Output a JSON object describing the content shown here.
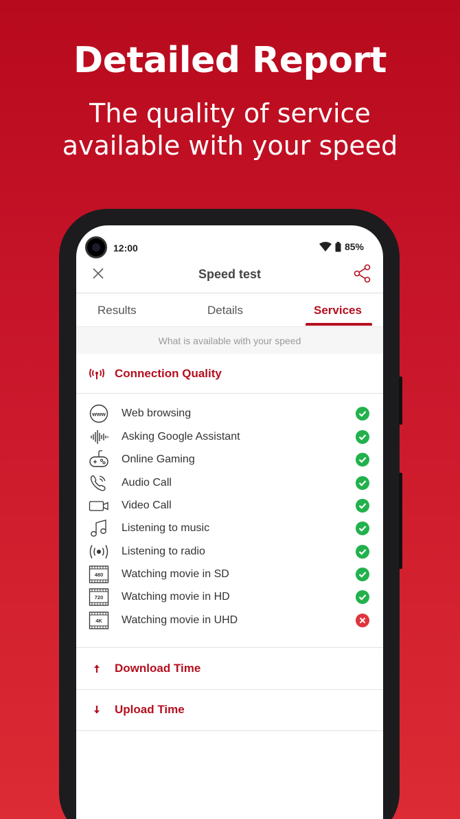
{
  "promo": {
    "title": "Detailed Report",
    "subtitle": "The quality of service available with your speed"
  },
  "status_bar": {
    "time": "12:00",
    "battery": "85%"
  },
  "app_bar": {
    "title": "Speed test"
  },
  "tabs": [
    {
      "label": "Results",
      "active": false
    },
    {
      "label": "Details",
      "active": false
    },
    {
      "label": "Services",
      "active": true
    }
  ],
  "subheader": "What is available with your speed",
  "sections": {
    "connection_quality": "Connection Quality",
    "download_time": "Download Time",
    "upload_time": "Upload Time"
  },
  "services": [
    {
      "label": "Web browsing",
      "icon": "www-icon",
      "available": true
    },
    {
      "label": "Asking Google Assistant",
      "icon": "voice-wave-icon",
      "available": true
    },
    {
      "label": "Online Gaming",
      "icon": "gamepad-icon",
      "available": true
    },
    {
      "label": "Audio Call",
      "icon": "phone-call-icon",
      "available": true
    },
    {
      "label": "Video Call",
      "icon": "video-camera-icon",
      "available": true
    },
    {
      "label": "Listening to music",
      "icon": "music-note-icon",
      "available": true
    },
    {
      "label": "Listening to radio",
      "icon": "radio-broadcast-icon",
      "available": true
    },
    {
      "label": "Watching movie in SD",
      "icon": "film-480-icon",
      "badge": "480",
      "available": true
    },
    {
      "label": "Watching movie in HD",
      "icon": "film-720-icon",
      "badge": "720",
      "available": true
    },
    {
      "label": "Watching movie in UHD",
      "icon": "film-4k-icon",
      "badge": "4K",
      "available": false
    }
  ],
  "colors": {
    "accent": "#b50f1f",
    "ok": "#22b14c",
    "fail": "#e0343f",
    "background": "#c8152a"
  }
}
